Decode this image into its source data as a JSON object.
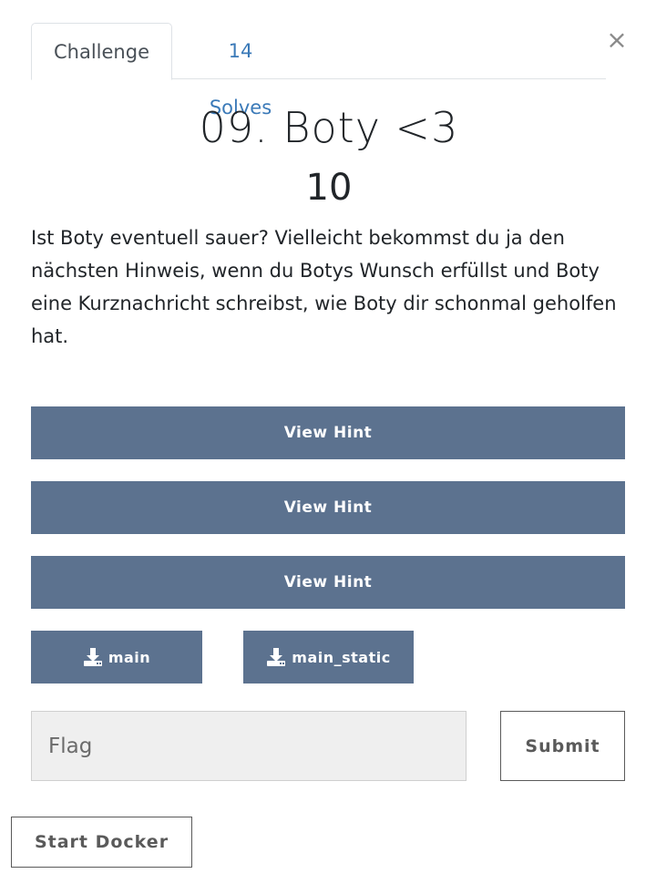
{
  "tabs": [
    {
      "label": "Challenge"
    },
    {
      "label": "14 Solves"
    }
  ],
  "close_glyph": "×",
  "challenge": {
    "title": "09. Boty <3",
    "value": "10",
    "description": "Ist Boty eventuell sauer? Vielleicht bekommst du ja den nächsten Hinweis, wenn du Botys Wunsch erfüllst und Boty eine Kurznachricht schreibst, wie Boty dir schonmal geholfen hat."
  },
  "hints": [
    {
      "label": "View Hint"
    },
    {
      "label": "View Hint"
    },
    {
      "label": "View Hint"
    }
  ],
  "files": [
    {
      "label": "main",
      "icon": "download-icon"
    },
    {
      "label": "main_static",
      "icon": "download-icon"
    }
  ],
  "flag": {
    "placeholder": "Flag",
    "value": ""
  },
  "submit_label": "Submit",
  "docker_label": "Start Docker",
  "colors": {
    "button_bg": "#5c728f",
    "tab_link": "#3b7ab8",
    "input_bg": "#efefef"
  }
}
